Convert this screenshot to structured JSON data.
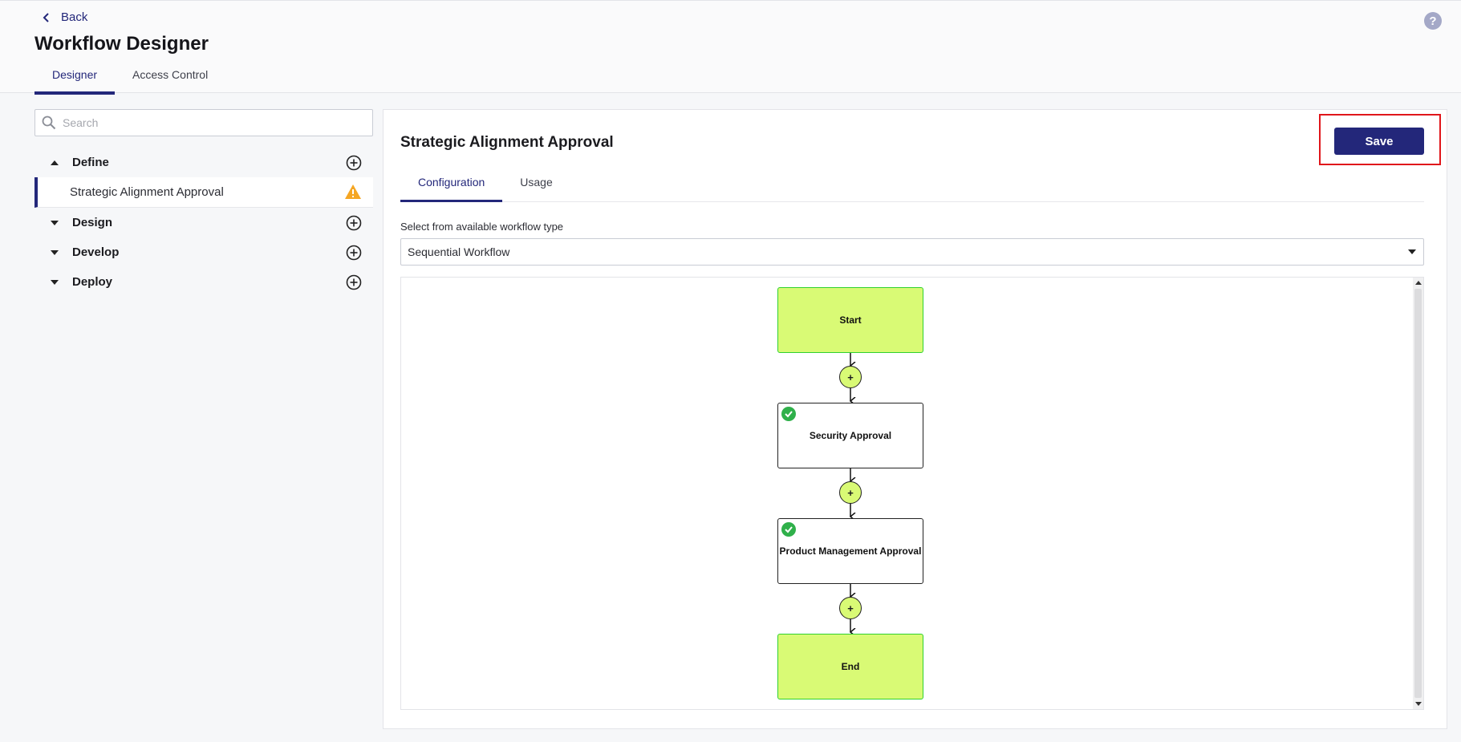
{
  "header": {
    "back_label": "Back",
    "title": "Workflow Designer",
    "tabs": [
      {
        "label": "Designer",
        "active": true
      },
      {
        "label": "Access Control",
        "active": false
      }
    ],
    "help_icon": "?"
  },
  "sidebar": {
    "search": {
      "placeholder": "Search",
      "value": ""
    },
    "groups": [
      {
        "label": "Define",
        "expanded": true,
        "items": [
          {
            "label": "Strategic Alignment Approval",
            "status": "warning"
          }
        ]
      },
      {
        "label": "Design",
        "expanded": false
      },
      {
        "label": "Develop",
        "expanded": false
      },
      {
        "label": "Deploy",
        "expanded": false
      }
    ]
  },
  "panel": {
    "title": "Strategic Alignment Approval",
    "save_label": "Save",
    "tabs": [
      {
        "label": "Configuration",
        "active": true
      },
      {
        "label": "Usage",
        "active": false
      }
    ],
    "workflow_type_label": "Select from available workflow type",
    "workflow_type_value": "Sequential Workflow"
  },
  "workflow": {
    "nodes": [
      {
        "label": "Start",
        "kind": "terminal"
      },
      {
        "label": "Security Approval",
        "kind": "approval",
        "checked": true
      },
      {
        "label": "Product Management Approval",
        "kind": "approval",
        "checked": true
      },
      {
        "label": "End",
        "kind": "terminal"
      }
    ],
    "add_step_symbol": "+"
  },
  "colors": {
    "accent": "#23277a",
    "terminal_fill": "#d9fa75",
    "terminal_border": "#2fd12f",
    "check": "#2fb04a",
    "warning": "#f5a623",
    "highlight": "#e0161b"
  }
}
